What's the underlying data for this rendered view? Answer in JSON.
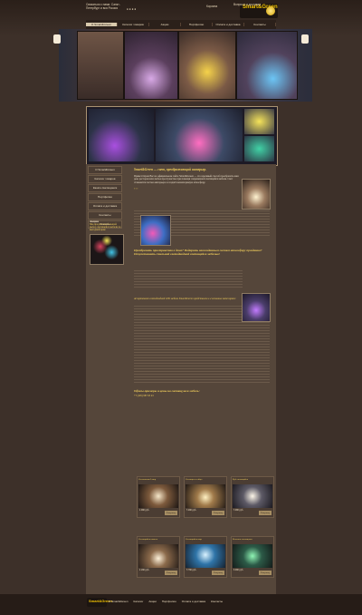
{
  "header": {
    "phone_note": "Связаться с нами: Санкт-Петербург и вся Россия",
    "site_brand": "Smart&Green",
    "cart_label": "Корзина",
    "cart_note": "Ваш заказ",
    "contact_note": "Вопросы и доставка"
  },
  "nav": [
    "О Smart&Green",
    "Каталог товаров",
    "Акции",
    "Портфолио",
    "Оплата и доставка",
    "Контакты"
  ],
  "sidebar": {
    "items": [
      "О Smart&Green",
      "Каталог товаров",
      "Кашпо светящиеся",
      "Портфолио",
      "Оплата и доставка",
      "Контакты",
      "Скачать"
    ]
  },
  "promo": {
    "title": "Акция",
    "text": "Мы предлагаем большой выбор светящейся мебели по выгодной цене"
  },
  "main": {
    "title": "Smart&Green — свет, преображающий интерьер.",
    "intro": "Приветствуем Вас на официальном сайте Smart&Green — это красивый способ преобразить ваш дом, ресторан или любое пространство при помощи современной светящейся мебели. Свет становится частью интерьера и создаёт неповторимую атмосферу.",
    "question": "Преобразить пространство в доме? Подарить неожиданным гостям атмосферу праздника? Почувствовать стильной светодиодной светящейся мебелью!",
    "sub": "Ассортимент светодиодной LED мебели Smart&Green представлен в 4 основных категориях:",
    "prices_title": "Офисы-примеры и цены на светящуюся мебель:",
    "price_note": "+7 (495) 987 65 43"
  },
  "products": [
    {
      "name": "Светильник Lamp",
      "price": "4 990 руб.",
      "cart": "В корзину"
    },
    {
      "name": "Светящееся яйцо",
      "price": "5 490 руб.",
      "cart": "В корзину"
    },
    {
      "name": "Куб светящийся",
      "price": "3 990 руб.",
      "cart": "В корзину"
    },
    {
      "name": "Светящийся камень",
      "price": "4 290 руб.",
      "cart": "В корзину"
    },
    {
      "name": "Светящийся шар",
      "price": "3 790 руб.",
      "cart": "В корзину"
    },
    {
      "name": "Колонна светящаяся",
      "price": "6 990 руб.",
      "cart": "В корзину"
    }
  ],
  "footer": {
    "logo": "Smart&Green",
    "nav": [
      "О Smart&Green",
      "Каталог",
      "Акции",
      "Портфолио",
      "Оплата и доставка",
      "Контакты"
    ]
  },
  "colors": {
    "accent": "#f2cf5c",
    "background": "#3b2e27",
    "panel": "#55463a"
  }
}
